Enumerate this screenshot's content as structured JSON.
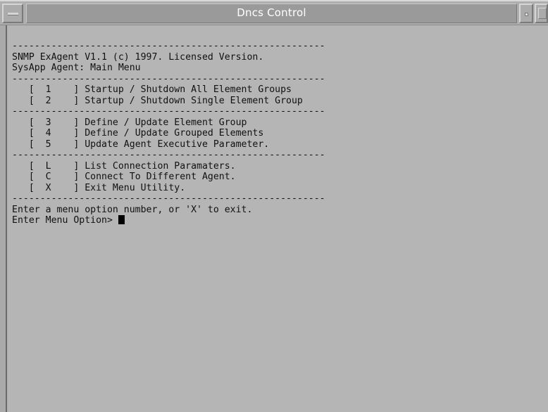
{
  "window": {
    "title": "Dncs Control"
  },
  "terminal": {
    "divider": "--------------------------------------------------------",
    "header": [
      "SNMP ExAgent V1.1 (c) 1997. Licensed Version.",
      "SysApp Agent: Main Menu"
    ],
    "menu_groups": [
      [
        {
          "key": "1",
          "label": "Startup / Shutdown All Element Groups"
        },
        {
          "key": "2",
          "label": "Startup / Shutdown Single Element Group"
        }
      ],
      [
        {
          "key": "3",
          "label": "Define / Update Element Group"
        },
        {
          "key": "4",
          "label": "Define / Update Grouped Elements"
        },
        {
          "key": "5",
          "label": "Update Agent Executive Parameter."
        }
      ],
      [
        {
          "key": "L",
          "label": "List Connection Paramaters."
        },
        {
          "key": "C",
          "label": "Connect To Different Agent."
        },
        {
          "key": "X",
          "label": "Exit Menu Utility."
        }
      ]
    ],
    "instruction": "Enter a menu option number, or 'X' to exit.",
    "prompt": "Enter Menu Option> "
  },
  "colors": {
    "background": "#b5b5b5",
    "text": "#111111",
    "title_text": "#ffffff"
  },
  "icons": {
    "window_menu": "window-menu-icon",
    "minimize": "minimize-icon",
    "maximize": "maximize-icon"
  }
}
